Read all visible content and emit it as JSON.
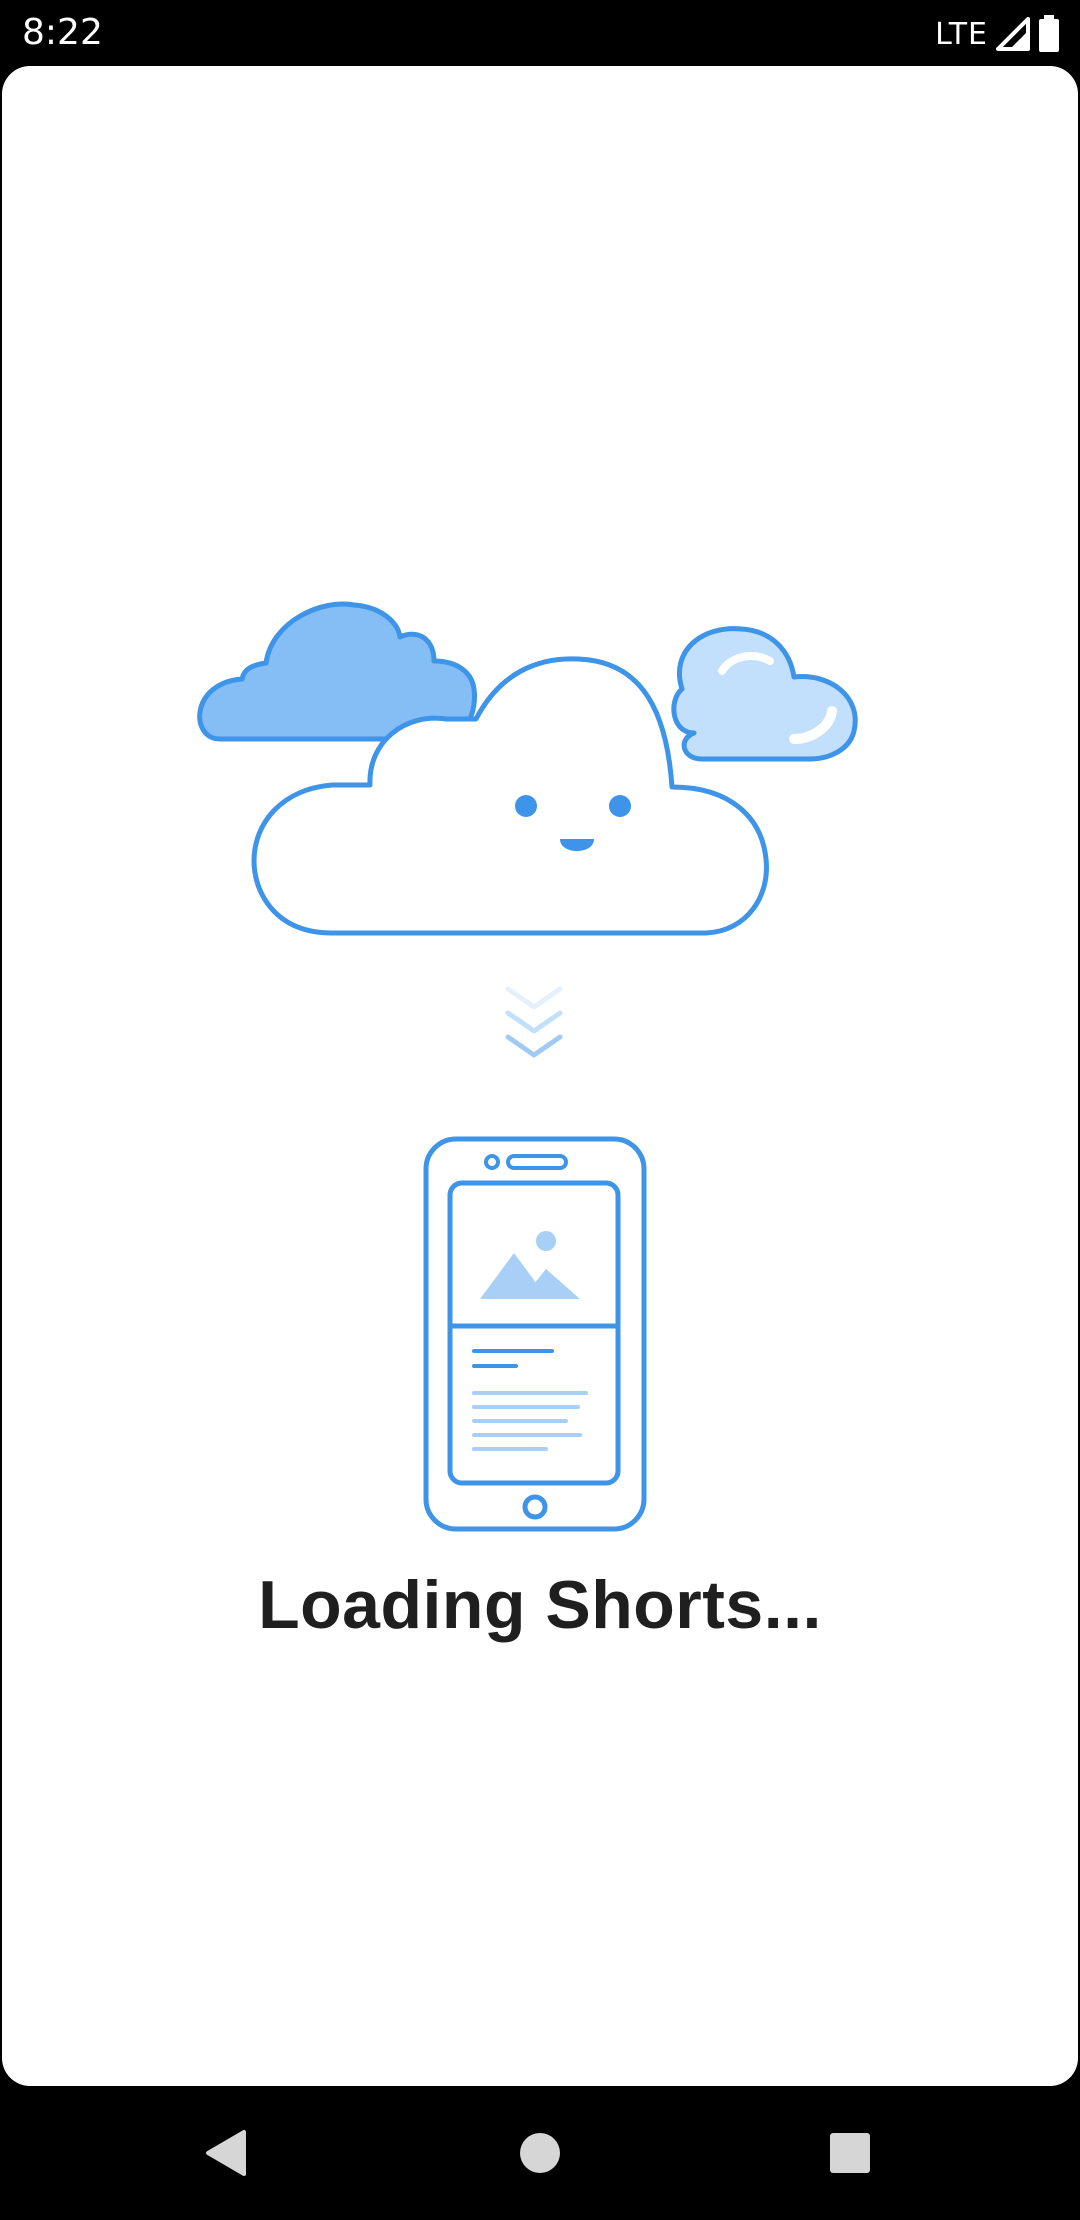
{
  "status_bar": {
    "time": "8:22",
    "network": "LTE",
    "icons": [
      "signal-icon",
      "battery-icon"
    ]
  },
  "main": {
    "loading_text": "Loading Shorts...",
    "illustration_icons": [
      "cloud-icon",
      "download-arrows-icon",
      "phone-icon"
    ]
  },
  "nav_bar": {
    "buttons": [
      "back",
      "home",
      "recents"
    ]
  },
  "colors": {
    "accent": "#3d94e8",
    "accent_fill": "#85bdf5",
    "accent_light": "#c2dffb",
    "text": "#1f1f1f",
    "background": "#ffffff",
    "bar": "#000000"
  }
}
